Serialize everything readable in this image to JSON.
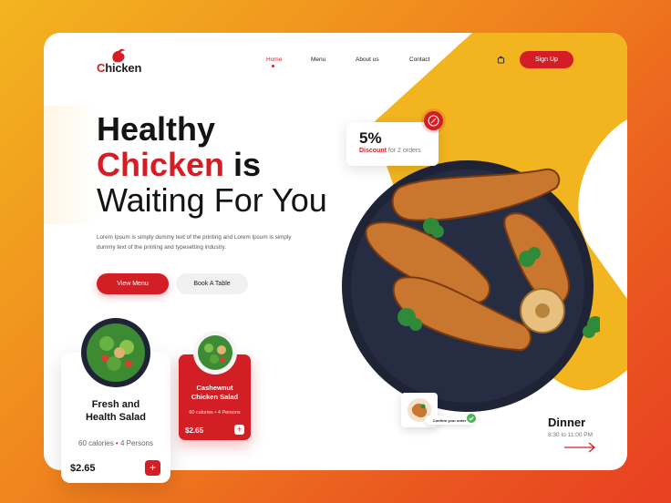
{
  "brand": {
    "name_first": "C",
    "name_rest": "hicken",
    "accent": "#d41e26",
    "yellow": "#f2b51f"
  },
  "nav": {
    "items": [
      "Home",
      "Menu",
      "About us",
      "Contact"
    ],
    "active": "Home"
  },
  "header": {
    "signup_label": "Sign Up",
    "cart_icon": "shopping-bag-icon"
  },
  "hero": {
    "line1": "Healthy",
    "line2_red": "Chicken",
    "line2_rest": " is",
    "line3": "Waiting For You",
    "description": "Lorem Ipsum is simply dummy text of the printing and Lorem Ipsum is simply dummy text of the printing and typesetting industry.",
    "primary_button": "View Menu",
    "secondary_button": "Book A Table"
  },
  "discount": {
    "percent": "5%",
    "label": "Discount",
    "suffix": " for 2 orders",
    "icon": "percent-badge-icon"
  },
  "confirm": {
    "label": "Confirm your order",
    "icon": "check-icon"
  },
  "dinner": {
    "title": "Dinner",
    "time": "8:30 to 11:00 PM",
    "icon": "arrow-right-icon"
  },
  "cards": [
    {
      "name_line1": "Fresh and",
      "name_line2": "Health Salad",
      "calories": "60 calories",
      "persons": "4 Persons",
      "price": "$2.65",
      "add": "+"
    },
    {
      "name_line1": "Cashewnut",
      "name_line2": "Chicken Salad",
      "calories": "60 calories",
      "persons": "4 Persons",
      "price": "$2.65",
      "add": "+"
    }
  ]
}
